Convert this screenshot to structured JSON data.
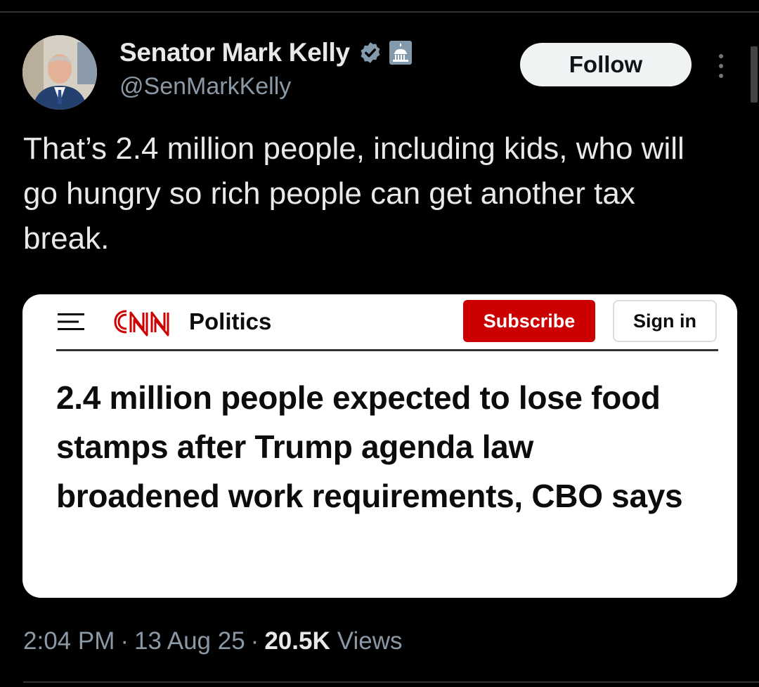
{
  "author": {
    "display_name": "Senator Mark Kelly",
    "handle": "@SenMarkKelly"
  },
  "actions": {
    "follow_label": "Follow"
  },
  "tweet": {
    "text": "That’s 2.4 million people, including kids, who will go hungry so rich people can get another tax break."
  },
  "card": {
    "brand": "CNN",
    "section": "Politics",
    "subscribe_label": "Subscribe",
    "signin_label": "Sign in",
    "headline": "2.4 million people expected to lose food stamps after Trump agenda law broadened work requirements, CBO says"
  },
  "meta": {
    "time": "2:04 PM",
    "date": "13 Aug 25",
    "views_count": "20.5K",
    "views_label": "Views",
    "separator": "·"
  },
  "icons": {
    "verified": "verified-badge-icon",
    "government": "capitol-icon",
    "more": "more-vertical-icon",
    "menu": "hamburger-menu-icon"
  },
  "colors": {
    "background": "#000000",
    "primary_text": "#e7e9ea",
    "secondary_text": "#8b98a5",
    "verified": "#829aab",
    "cnn_red": "#cc0000"
  }
}
